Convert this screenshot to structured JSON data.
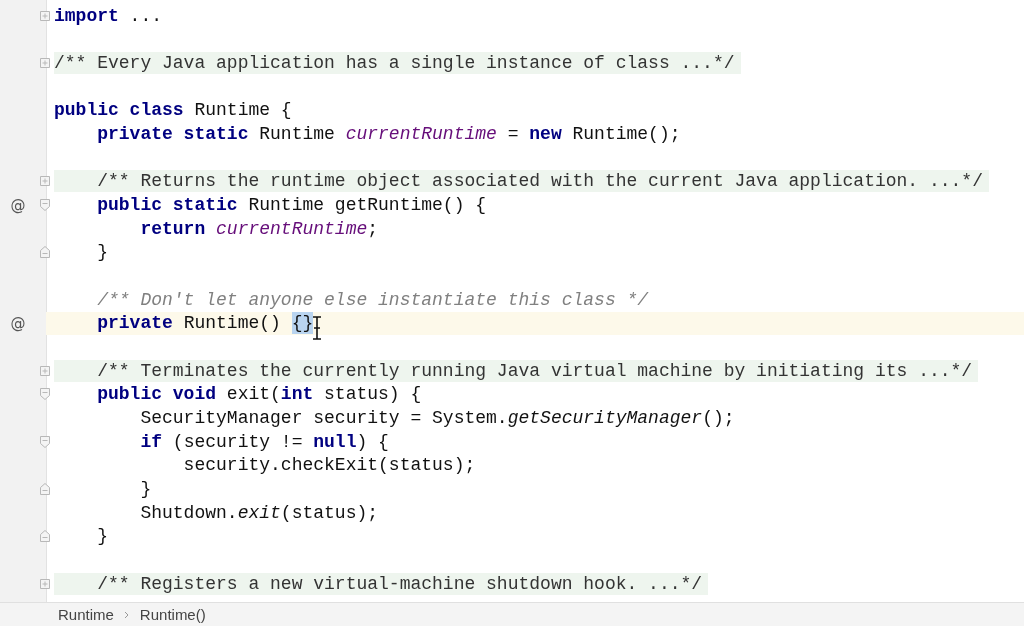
{
  "editor": {
    "lines": [
      {
        "kind": "code",
        "folded": true,
        "segments": [
          {
            "kind": "keyword",
            "text": "import"
          },
          {
            "kind": "plain",
            "text": " ..."
          }
        ]
      },
      {
        "kind": "blank"
      },
      {
        "kind": "doc",
        "folded": true,
        "segments": [
          {
            "kind": "plain",
            "text": "/** Every Java application has a single instance of class ...*/"
          }
        ]
      },
      {
        "kind": "blank"
      },
      {
        "kind": "code",
        "segments": [
          {
            "kind": "keyword",
            "text": "public class"
          },
          {
            "kind": "plain",
            "text": " Runtime {"
          }
        ]
      },
      {
        "kind": "code",
        "segments": [
          {
            "kind": "keyword",
            "text": "    private static"
          },
          {
            "kind": "plain",
            "text": " Runtime "
          },
          {
            "kind": "field",
            "text": "currentRuntime"
          },
          {
            "kind": "plain",
            "text": " = "
          },
          {
            "kind": "keyword",
            "text": "new"
          },
          {
            "kind": "plain",
            "text": " Runtime();"
          }
        ]
      },
      {
        "kind": "blank"
      },
      {
        "kind": "doc",
        "folded": true,
        "segments": [
          {
            "kind": "plain",
            "text": "    /** Returns the runtime object associated with the current Java application. ...*/"
          }
        ]
      },
      {
        "kind": "code",
        "fold_start": true,
        "marker": "@",
        "segments": [
          {
            "kind": "keyword",
            "text": "    public static"
          },
          {
            "kind": "plain",
            "text": " Runtime getRuntime() {"
          }
        ]
      },
      {
        "kind": "code",
        "segments": [
          {
            "kind": "keyword",
            "text": "        return "
          },
          {
            "kind": "field",
            "text": "currentRuntime"
          },
          {
            "kind": "plain",
            "text": ";"
          }
        ]
      },
      {
        "kind": "code",
        "fold_end": true,
        "segments": [
          {
            "kind": "plain",
            "text": "    }"
          }
        ]
      },
      {
        "kind": "blank"
      },
      {
        "kind": "comment",
        "segments": [
          {
            "kind": "plain",
            "text": "    /** Don't let anyone else instantiate this class */"
          }
        ]
      },
      {
        "kind": "code",
        "current": true,
        "marker": "@",
        "selection": "{}",
        "segments": [
          {
            "kind": "keyword",
            "text": "    private"
          },
          {
            "kind": "plain",
            "text": " Runtime() "
          }
        ]
      },
      {
        "kind": "blank"
      },
      {
        "kind": "doc",
        "folded": true,
        "segments": [
          {
            "kind": "plain",
            "text": "    /** Terminates the currently running Java virtual machine by initiating its ...*/"
          }
        ]
      },
      {
        "kind": "code",
        "fold_start": true,
        "segments": [
          {
            "kind": "keyword",
            "text": "    public void"
          },
          {
            "kind": "plain",
            "text": " exit("
          },
          {
            "kind": "keyword",
            "text": "int"
          },
          {
            "kind": "plain",
            "text": " status) {"
          }
        ]
      },
      {
        "kind": "code",
        "segments": [
          {
            "kind": "plain",
            "text": "        SecurityManager security = System."
          },
          {
            "kind": "static",
            "text": "getSecurityManager"
          },
          {
            "kind": "plain",
            "text": "();"
          }
        ]
      },
      {
        "kind": "code",
        "fold_start": true,
        "segments": [
          {
            "kind": "keyword",
            "text": "        if"
          },
          {
            "kind": "plain",
            "text": " (security != "
          },
          {
            "kind": "keyword",
            "text": "null"
          },
          {
            "kind": "plain",
            "text": ") {"
          }
        ]
      },
      {
        "kind": "code",
        "segments": [
          {
            "kind": "plain",
            "text": "            security.checkExit(status);"
          }
        ]
      },
      {
        "kind": "code",
        "fold_end": true,
        "segments": [
          {
            "kind": "plain",
            "text": "        }"
          }
        ]
      },
      {
        "kind": "code",
        "segments": [
          {
            "kind": "plain",
            "text": "        Shutdown."
          },
          {
            "kind": "static",
            "text": "exit"
          },
          {
            "kind": "plain",
            "text": "(status);"
          }
        ]
      },
      {
        "kind": "code",
        "fold_end": true,
        "segments": [
          {
            "kind": "plain",
            "text": "    }"
          }
        ]
      },
      {
        "kind": "blank"
      },
      {
        "kind": "doc",
        "folded": true,
        "segments": [
          {
            "kind": "plain",
            "text": "    /** Registers a new virtual-machine shutdown hook. ...*/"
          }
        ]
      }
    ]
  },
  "breadcrumbs": [
    "Runtime",
    "Runtime()"
  ]
}
